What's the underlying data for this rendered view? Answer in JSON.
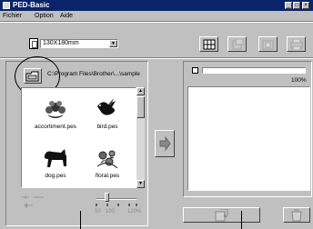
{
  "window": {
    "title": "PED-Basic",
    "controls": [
      "_",
      "□",
      "×"
    ]
  },
  "menu": {
    "items": [
      "Fichier",
      "Option",
      "Aide"
    ]
  },
  "toolbar": {
    "hoop_size": "130X180mm",
    "buttons": [
      {
        "icon": "grid-icon",
        "enabled": true
      },
      {
        "icon": "card-write-icon",
        "enabled": false
      },
      {
        "icon": "card-read-icon",
        "enabled": false
      },
      {
        "icon": "printer-icon",
        "enabled": false
      }
    ]
  },
  "browser": {
    "path": "C:\\Program Files\\Brother\\...\\sample",
    "files": [
      {
        "name": "accortiment.pes",
        "icon": "flower-embroidery-icon"
      },
      {
        "name": "bird.pes",
        "icon": "bird-embroidery-icon"
      },
      {
        "name": "dog.pes",
        "icon": "dog-embroidery-icon"
      },
      {
        "name": "floral.pes",
        "icon": "floral-embroidery-icon"
      }
    ]
  },
  "zoom": {
    "labels": [
      "50",
      "100",
      "120%"
    ],
    "level": 100
  },
  "card": {
    "progress_percent": 0,
    "progress_label": "100%"
  }
}
